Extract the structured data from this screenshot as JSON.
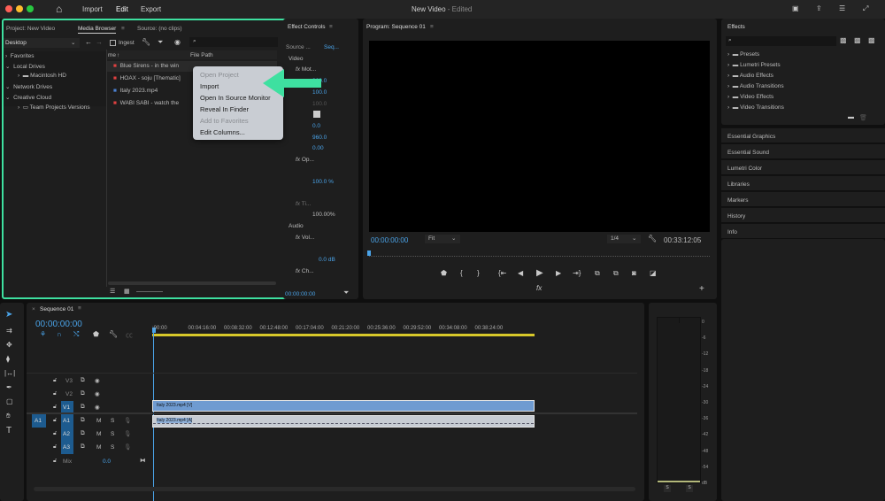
{
  "window": {
    "title": "New Video",
    "title_suffix": " - Edited",
    "menu": [
      "Import",
      "Edit",
      "Export"
    ],
    "active_menu": "Edit"
  },
  "left_panel": {
    "tabs": [
      "Project: New Video",
      "Media Browser",
      "Source: (no clips)"
    ],
    "active_tab": "Media Browser",
    "location": "Desktop",
    "ingest_label": "Ingest",
    "search_placeholder": "",
    "tree": [
      {
        "label": "Favorites",
        "expanded": false
      },
      {
        "label": "Local Drives",
        "expanded": true
      },
      {
        "label": "Macintosh HD",
        "child": true
      },
      {
        "label": "Network Drives",
        "expanded": true
      },
      {
        "label": "Creative Cloud",
        "expanded": true
      },
      {
        "label": "Team Projects Versions",
        "child": true
      }
    ],
    "columns": [
      "me",
      "File Path"
    ],
    "files": [
      "Blue Sirens - in the win",
      "HOAX - soju [Thematic]",
      "Italy 2023.mp4",
      "WABI SABI - watch the"
    ]
  },
  "context_menu": {
    "items": [
      {
        "label": "Open Project",
        "enabled": false
      },
      {
        "label": "Import",
        "enabled": true
      },
      {
        "label": "Open In Source Monitor",
        "enabled": true
      },
      {
        "label": "Reveal In Finder",
        "enabled": true
      },
      {
        "label": "Add to Favorites",
        "enabled": false
      },
      {
        "label": "Edit Columns...",
        "enabled": true
      }
    ]
  },
  "effect_controls": {
    "title": "Effect Controls",
    "source": "Source ...",
    "seq": "Seq...",
    "video_label": "Video",
    "audio_label": "Audio",
    "motion": "Mot...",
    "opacity": "Op...",
    "time": "Ti...",
    "volume": "Vol...",
    "channel": "Ch...",
    "values": [
      "960.0",
      "100.0",
      "100.0",
      "0.0",
      "960.0",
      "0.00",
      "100.0 %",
      "100.00%",
      "0.0 dB"
    ],
    "timecode": "00:00:00:00"
  },
  "program": {
    "title": "Program: Sequence 01",
    "timecode": "00:00:00:00",
    "fit": "Fit",
    "quality": "1/4",
    "duration": "00:33:12:05"
  },
  "effects": {
    "title": "Effects",
    "folders": [
      "Presets",
      "Lumetri Presets",
      "Audio Effects",
      "Audio Transitions",
      "Video Effects",
      "Video Transitions"
    ],
    "panels": [
      "Essential Graphics",
      "Essential Sound",
      "Lumetri Color",
      "Libraries",
      "Markers",
      "History",
      "Info"
    ]
  },
  "timeline": {
    "title": "Sequence 01",
    "timecode": "00:00:00:00",
    "ruler": [
      ":00:00",
      "00:04:16:00",
      "00:08:32:00",
      "00:12:48:00",
      "00:17:04:00",
      "00:21:20:00",
      "00:25:36:00",
      "00:29:52:00",
      "00:34:08:00",
      "00:38:24:00"
    ],
    "video_tracks": [
      "V3",
      "V2",
      "V1"
    ],
    "audio_tracks": [
      "A1",
      "A2",
      "A3"
    ],
    "source_patch": "A1",
    "mix_label": "Mix",
    "mix_value": "0.0",
    "clip_video": "Italy 2023.mp4 [V]",
    "clip_audio": "Italy 2023.mp4 [A]",
    "m": "M",
    "s": "S"
  },
  "meter": {
    "scale": [
      "0",
      "-6",
      "-12",
      "-18",
      "-24",
      "-30",
      "-36",
      "-42",
      "-48",
      "-54",
      "dB"
    ],
    "solo": [
      "S",
      "S"
    ]
  },
  "colors": {
    "highlight": "#3ee0a0",
    "accent": "#4aa3e8",
    "clip_video": "#6f9bd1"
  }
}
